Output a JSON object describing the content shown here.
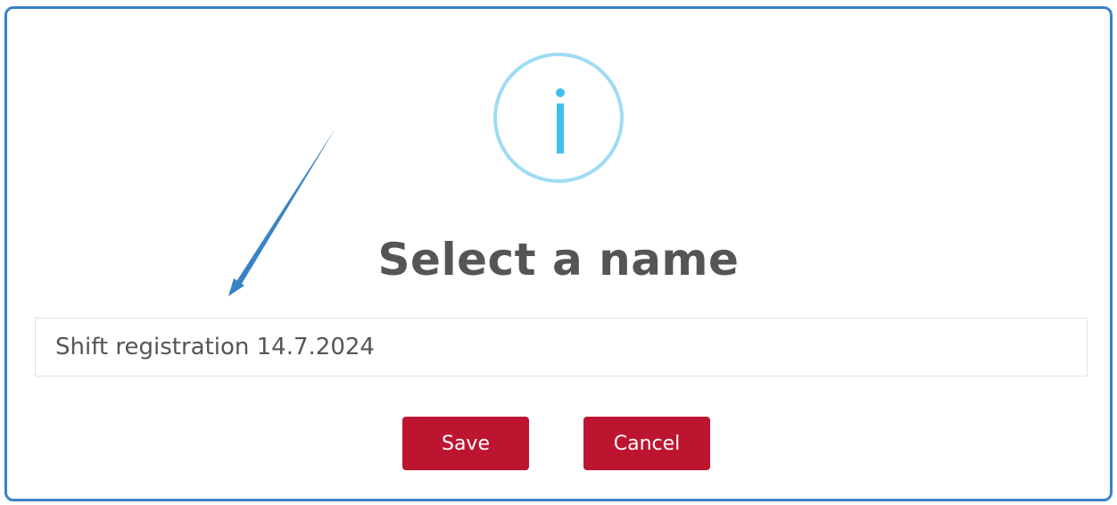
{
  "dialog": {
    "icon": "info-icon",
    "title": "Select a name",
    "name_input": {
      "value": "Shift registration 14.7.2024"
    },
    "buttons": {
      "save_label": "Save",
      "cancel_label": "Cancel"
    }
  },
  "annotation": {
    "icon": "arrow-annotation"
  },
  "colors": {
    "border": "#3a82c4",
    "icon_ring": "#9fdcf4",
    "icon_glyph": "#3fc0ea",
    "button": "#bd1530",
    "title_text": "#555555"
  }
}
